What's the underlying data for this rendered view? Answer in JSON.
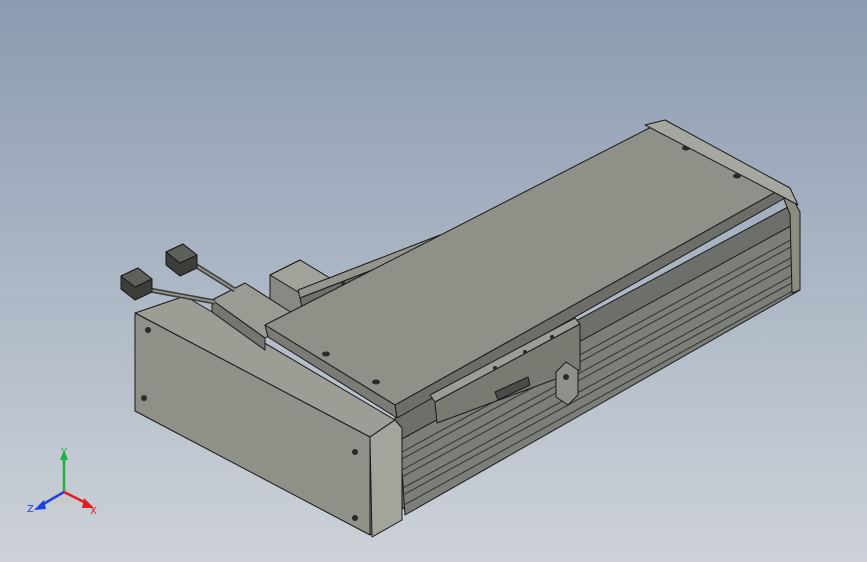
{
  "viewport": {
    "background_top": "#8c9bb2",
    "background_bottom": "#cdd2d8"
  },
  "model": {
    "name": "linear-actuator",
    "body_color": "#8b8d83",
    "edge_color": "#1a1a1a"
  },
  "triad": {
    "x_label": "X",
    "y_label": "Y",
    "z_label": "Z",
    "x_color": "#e02020",
    "y_color": "#20b040",
    "z_color": "#2040e0"
  }
}
